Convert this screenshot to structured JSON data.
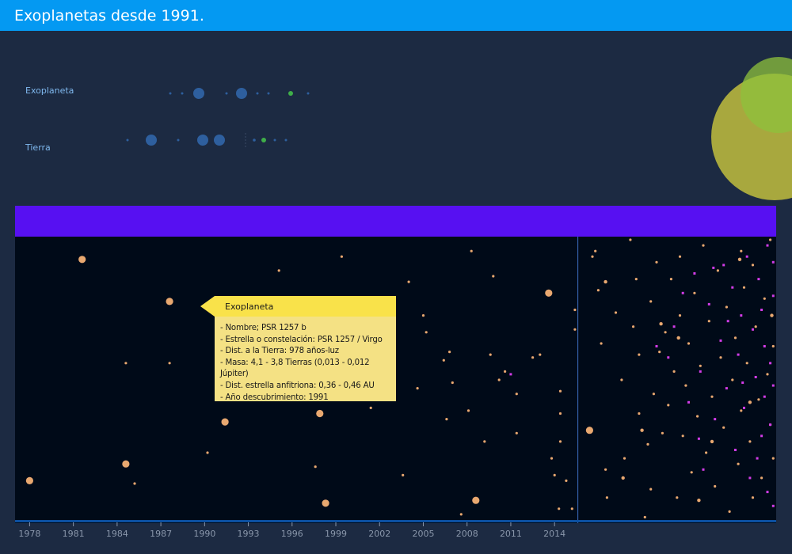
{
  "header": {
    "title": "Exoplanetas desde 1991."
  },
  "legend": {
    "rows": [
      {
        "label": "Exoplaneta"
      },
      {
        "label": "Tierra"
      }
    ],
    "colors": {
      "dot": "#2e5f9e",
      "highlight": "#3fae49"
    }
  },
  "tooltip": {
    "title": "Exoplaneta",
    "lines": [
      "- Nombre; PSR 1257 b",
      "- Estrella o constelación: PSR 1257 / Virgo",
      "- Dist. a la Tierra: 978 años-luz",
      "- Masa: 4,1 - 3,8 Tierras (0,013 - 0,012 Júpiter)",
      "- Dist. estrella anfitriona: 0,36 - 0,46 AU",
      "- Año descubrimiento: 1991"
    ]
  },
  "chart_data": {
    "type": "scatter",
    "xlabel": "",
    "ylabel": "",
    "title": "",
    "xlim": [
      1977,
      2029.2
    ],
    "x_ticks": [
      "1978",
      "1981",
      "1984",
      "1987",
      "1990",
      "1993",
      "1996",
      "1999",
      "2002",
      "2005",
      "2008",
      "2011",
      "2014"
    ],
    "marker_year": 2015.6,
    "colors": {
      "planet": "#e8a870",
      "magenta": "#d23ce8",
      "tick": "#8a97ab",
      "axis": "#0b4fa0"
    },
    "series": [
      {
        "points": [
          [
            1978.0,
            0.86,
            5
          ],
          [
            1981.6,
            0.07,
            5
          ],
          [
            1984.6,
            0.8,
            5
          ],
          [
            1987.6,
            0.22,
            5
          ],
          [
            1985.2,
            0.87,
            3
          ],
          [
            1984.6,
            0.44,
            3
          ],
          [
            1987.6,
            0.44,
            3
          ],
          [
            1991.4,
            0.65,
            5
          ],
          [
            1990.2,
            0.76,
            3
          ],
          [
            1995.1,
            0.11,
            3
          ],
          [
            1999.4,
            0.06,
            3
          ],
          [
            1997.9,
            0.62,
            5
          ],
          [
            1997.6,
            0.81,
            3
          ],
          [
            1998.3,
            0.94,
            5
          ],
          [
            2001.4,
            0.6,
            3
          ],
          [
            2003.6,
            0.84,
            3
          ],
          [
            2004.6,
            0.53,
            3
          ],
          [
            2004.0,
            0.15,
            3
          ],
          [
            2005.0,
            0.27,
            3
          ],
          [
            2005.2,
            0.33,
            3
          ],
          [
            2006.4,
            0.43,
            3
          ],
          [
            2006.8,
            0.4,
            3
          ],
          [
            2007.0,
            0.51,
            3
          ],
          [
            2006.6,
            0.64,
            3
          ],
          [
            2007.6,
            0.98,
            3
          ],
          [
            2008.1,
            0.61,
            3
          ],
          [
            2008.3,
            0.04,
            3
          ],
          [
            2008.6,
            0.93,
            5
          ],
          [
            2009.2,
            0.72,
            3
          ],
          [
            2009.6,
            0.41,
            3
          ],
          [
            2009.8,
            0.13,
            3
          ],
          [
            2010.2,
            0.5,
            3
          ],
          [
            2010.6,
            0.47,
            3
          ],
          [
            2011.4,
            0.55,
            3
          ],
          [
            2011.4,
            0.69,
            3
          ],
          [
            2012.5,
            0.42,
            3
          ],
          [
            2013.8,
            0.78,
            3
          ],
          [
            2013.0,
            0.41,
            3
          ],
          [
            2013.6,
            0.19,
            5
          ],
          [
            2014.0,
            0.84,
            3
          ],
          [
            2014.3,
            0.96,
            3
          ],
          [
            2014.4,
            0.54,
            3
          ],
          [
            2014.4,
            0.62,
            3
          ],
          [
            2014.4,
            0.72,
            3
          ],
          [
            2014.8,
            0.86,
            3
          ],
          [
            2015.2,
            0.96,
            3
          ],
          [
            2015.4,
            0.32,
            3
          ],
          [
            2015.4,
            0.25,
            3
          ],
          [
            2016.4,
            0.68,
            5
          ],
          [
            2016.6,
            0.06,
            3
          ],
          [
            2016.8,
            0.04,
            3
          ],
          [
            2017.0,
            0.18,
            3
          ],
          [
            2017.2,
            0.37,
            3
          ],
          [
            2017.5,
            0.82,
            3
          ],
          [
            2017.6,
            0.92,
            3
          ],
          [
            2018.2,
            0.26,
            3
          ],
          [
            2018.6,
            0.5,
            3
          ],
          [
            2018.8,
            0.78,
            3
          ],
          [
            2019.2,
            0.0,
            3
          ],
          [
            2019.4,
            0.31,
            3
          ],
          [
            2019.6,
            0.14,
            3
          ],
          [
            2019.8,
            0.41,
            3
          ],
          [
            2019.8,
            0.62,
            3
          ],
          [
            2020.2,
            0.99,
            3
          ],
          [
            2020.4,
            0.73,
            3
          ],
          [
            2020.6,
            0.22,
            3
          ],
          [
            2020.6,
            0.89,
            3
          ],
          [
            2020.8,
            0.55,
            3
          ],
          [
            2021.0,
            0.08,
            3
          ],
          [
            2021.2,
            0.4,
            3
          ],
          [
            2021.4,
            0.69,
            3
          ],
          [
            2021.6,
            0.33,
            3
          ],
          [
            2021.8,
            0.59,
            3
          ],
          [
            2022.0,
            0.14,
            3
          ],
          [
            2022.2,
            0.47,
            3
          ],
          [
            2022.4,
            0.92,
            3
          ],
          [
            2022.6,
            0.06,
            3
          ],
          [
            2022.6,
            0.27,
            3
          ],
          [
            2022.8,
            0.7,
            3
          ],
          [
            2023.0,
            0.52,
            3
          ],
          [
            2023.2,
            0.37,
            3
          ],
          [
            2023.4,
            0.83,
            3
          ],
          [
            2023.6,
            0.19,
            3
          ],
          [
            2023.8,
            0.63,
            3
          ],
          [
            2024.0,
            0.45,
            3
          ],
          [
            2024.2,
            0.02,
            3
          ],
          [
            2024.4,
            0.76,
            3
          ],
          [
            2024.6,
            0.29,
            3
          ],
          [
            2024.8,
            0.56,
            3
          ],
          [
            2025.0,
            0.88,
            3
          ],
          [
            2025.2,
            0.11,
            3
          ],
          [
            2025.4,
            0.42,
            3
          ],
          [
            2025.6,
            0.67,
            3
          ],
          [
            2025.8,
            0.24,
            3
          ],
          [
            2026.0,
            0.97,
            3
          ],
          [
            2026.2,
            0.5,
            3
          ],
          [
            2026.4,
            0.35,
            3
          ],
          [
            2026.6,
            0.8,
            3
          ],
          [
            2026.8,
            0.04,
            3
          ],
          [
            2026.8,
            0.61,
            3
          ],
          [
            2027.0,
            0.17,
            3
          ],
          [
            2027.2,
            0.44,
            3
          ],
          [
            2027.4,
            0.72,
            3
          ],
          [
            2027.6,
            0.09,
            3
          ],
          [
            2027.6,
            0.92,
            3
          ],
          [
            2027.8,
            0.31,
            3
          ],
          [
            2028.0,
            0.57,
            3
          ],
          [
            2028.2,
            0.85,
            3
          ],
          [
            2028.4,
            0.21,
            3
          ],
          [
            2028.6,
            0.48,
            3
          ],
          [
            2028.8,
            0.0,
            3
          ],
          [
            2028.8,
            0.66,
            3
          ],
          [
            2029.0,
            0.38,
            3
          ],
          [
            2029.0,
            0.78,
            3
          ],
          [
            2022.5,
            0.35,
            4
          ],
          [
            2024.8,
            0.72,
            4
          ],
          [
            2026.7,
            0.07,
            4
          ],
          [
            2027.4,
            0.58,
            4
          ],
          [
            2028.9,
            0.27,
            4
          ],
          [
            2017.5,
            0.15,
            4
          ],
          [
            2020.0,
            0.68,
            4
          ],
          [
            2021.3,
            0.3,
            4
          ],
          [
            2018.7,
            0.85,
            4
          ],
          [
            2023.9,
            0.93,
            4
          ]
        ]
      },
      {
        "points": [
          [
            2021.0,
            0.38
          ],
          [
            2021.8,
            0.42
          ],
          [
            2022.2,
            0.31
          ],
          [
            2022.8,
            0.19
          ],
          [
            2023.2,
            0.58
          ],
          [
            2023.6,
            0.12
          ],
          [
            2024.0,
            0.47
          ],
          [
            2024.2,
            0.82
          ],
          [
            2024.6,
            0.23
          ],
          [
            2025.0,
            0.64
          ],
          [
            2025.4,
            0.36
          ],
          [
            2025.6,
            0.09
          ],
          [
            2025.8,
            0.53
          ],
          [
            2026.2,
            0.17
          ],
          [
            2026.4,
            0.75
          ],
          [
            2026.6,
            0.41
          ],
          [
            2026.8,
            0.27
          ],
          [
            2027.0,
            0.6
          ],
          [
            2027.2,
            0.06
          ],
          [
            2027.4,
            0.85
          ],
          [
            2027.6,
            0.32
          ],
          [
            2027.8,
            0.49
          ],
          [
            2028.0,
            0.14
          ],
          [
            2028.2,
            0.7
          ],
          [
            2028.2,
            0.25
          ],
          [
            2028.4,
            0.56
          ],
          [
            2028.6,
            0.02
          ],
          [
            2028.6,
            0.9
          ],
          [
            2028.8,
            0.44
          ],
          [
            2028.8,
            0.66
          ],
          [
            2029.0,
            0.2
          ],
          [
            2029.0,
            0.08
          ],
          [
            2029.0,
            0.52
          ],
          [
            2029.0,
            0.95
          ],
          [
            2028.4,
            0.38
          ],
          [
            2027.9,
            0.78
          ],
          [
            2026.9,
            0.51
          ],
          [
            2025.9,
            0.29
          ],
          [
            2024.9,
            0.1
          ],
          [
            2023.9,
            0.71
          ],
          [
            2011.0,
            0.48
          ]
        ]
      }
    ]
  },
  "decor": {
    "big_circle": "#a8a83e",
    "small_circle": "#8ec23c"
  }
}
